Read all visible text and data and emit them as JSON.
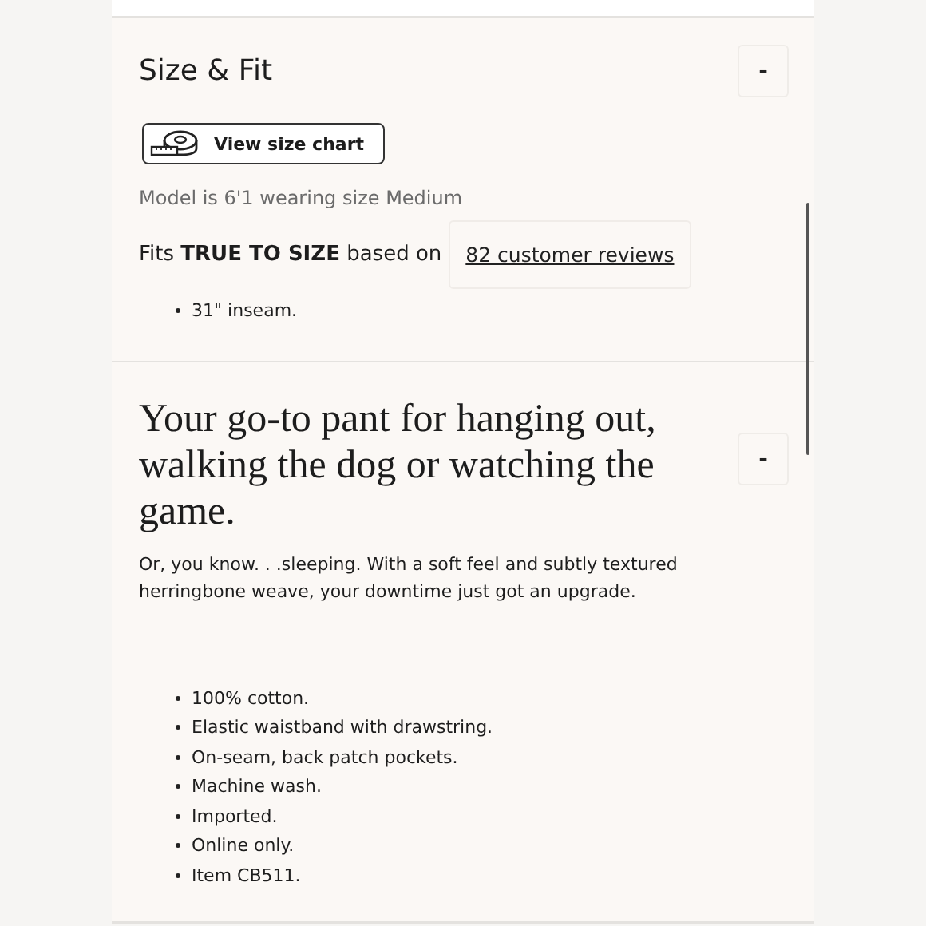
{
  "size_fit": {
    "title": "Size & Fit",
    "toggle": "-",
    "size_chart_button": "View size chart",
    "model_note": "Model is 6'1 wearing size Medium",
    "fit_text": "Fits **TRUE TO SIZE** based on",
    "reviews_link": "82 customer reviews",
    "details": [
      "31\" inseam."
    ]
  },
  "description": {
    "heading": "Your go-to pant for hanging out, walking the dog or watching the game.",
    "toggle": "-",
    "body": "Or, you know. . .sleeping. With a soft feel and subtly textured herringbone weave, your downtime just got an upgrade.",
    "features": [
      "100% cotton.",
      "Elastic waistband with drawstring.",
      "On-seam, back patch pockets.",
      "Machine wash.",
      "Imported.",
      "Online only.",
      "Item CB511."
    ]
  }
}
